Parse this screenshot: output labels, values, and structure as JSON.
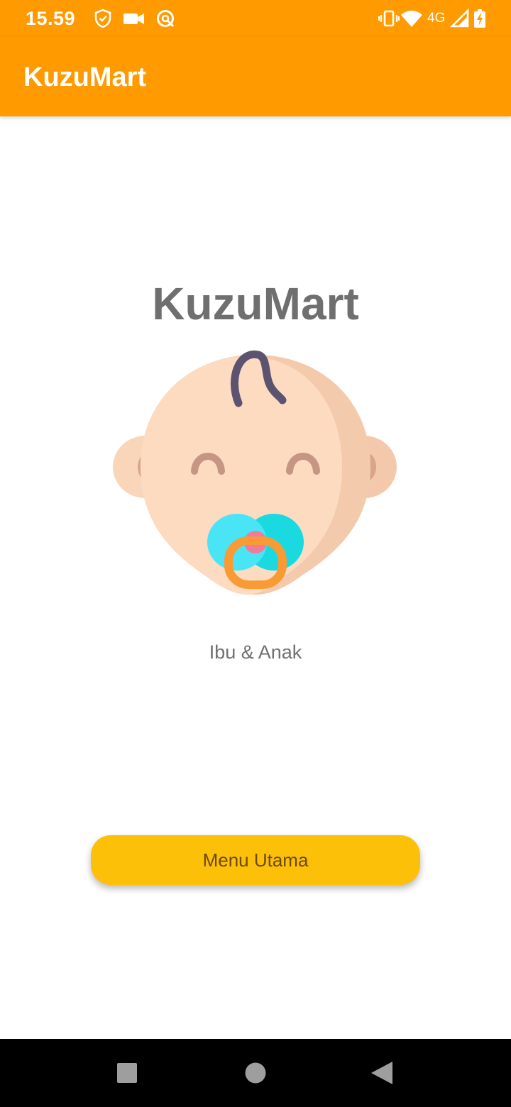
{
  "status_bar": {
    "time": "15.59",
    "network_label": "4G",
    "background_color": "#FF9A00",
    "icons": [
      "shield-check-icon",
      "video-camera-icon",
      "data-saver-icon",
      "vibrate-icon",
      "wifi-icon",
      "signal-icon",
      "battery-charging-icon"
    ]
  },
  "app_bar": {
    "title": "KuzuMart",
    "background_color": "#FF9A00"
  },
  "main": {
    "brand_title": "KuzuMart",
    "illustration": "baby-face-with-pacifier",
    "subtitle": "Ibu & Anak",
    "button_label": "Menu Utama",
    "button_color": "#FDC009"
  },
  "nav_bar": {
    "buttons": [
      "recents-square-icon",
      "home-circle-icon",
      "back-triangle-icon"
    ]
  }
}
